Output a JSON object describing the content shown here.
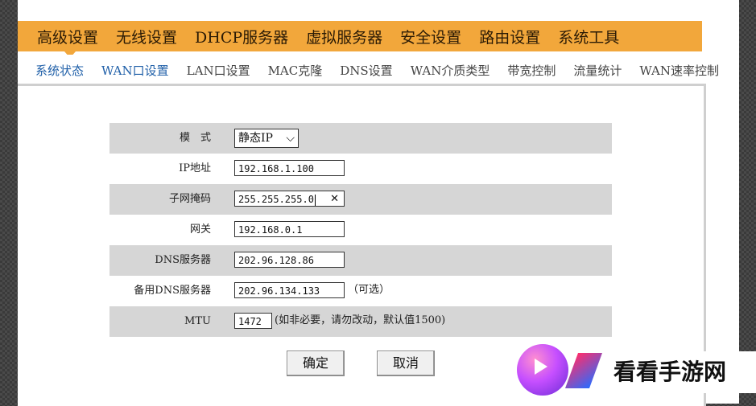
{
  "top_nav": [
    "高级设置",
    "无线设置",
    "DHCP服务器",
    "虚拟服务器",
    "安全设置",
    "路由设置",
    "系统工具"
  ],
  "sub_nav": [
    "系统状态",
    "WAN口设置",
    "LAN口设置",
    "MAC克隆",
    "DNS设置",
    "WAN介质类型",
    "带宽控制",
    "流量统计",
    "WAN速率控制"
  ],
  "form": {
    "mode_label": "模　式",
    "mode_value": "静态IP",
    "ip_label": "IP地址",
    "ip_value": "192.168.1.100",
    "mask_label": "子网掩码",
    "mask_value": "255.255.255.0",
    "gateway_label": "网关",
    "gateway_value": "192.168.0.1",
    "dns_label": "DNS服务器",
    "dns_value": "202.96.128.86",
    "dns2_label": "备用DNS服务器",
    "dns2_value": "202.96.134.133",
    "dns2_note": "（可选）",
    "mtu_label": "MTU",
    "mtu_value": "1472",
    "mtu_note": "(如非必要，请勿改动，默认值1500)"
  },
  "buttons": {
    "ok": "确定",
    "cancel": "取消"
  },
  "watermark": {
    "text": "看看手游网"
  },
  "icons": {
    "clear": "close-icon",
    "dropdown": "chevron-down-icon"
  }
}
